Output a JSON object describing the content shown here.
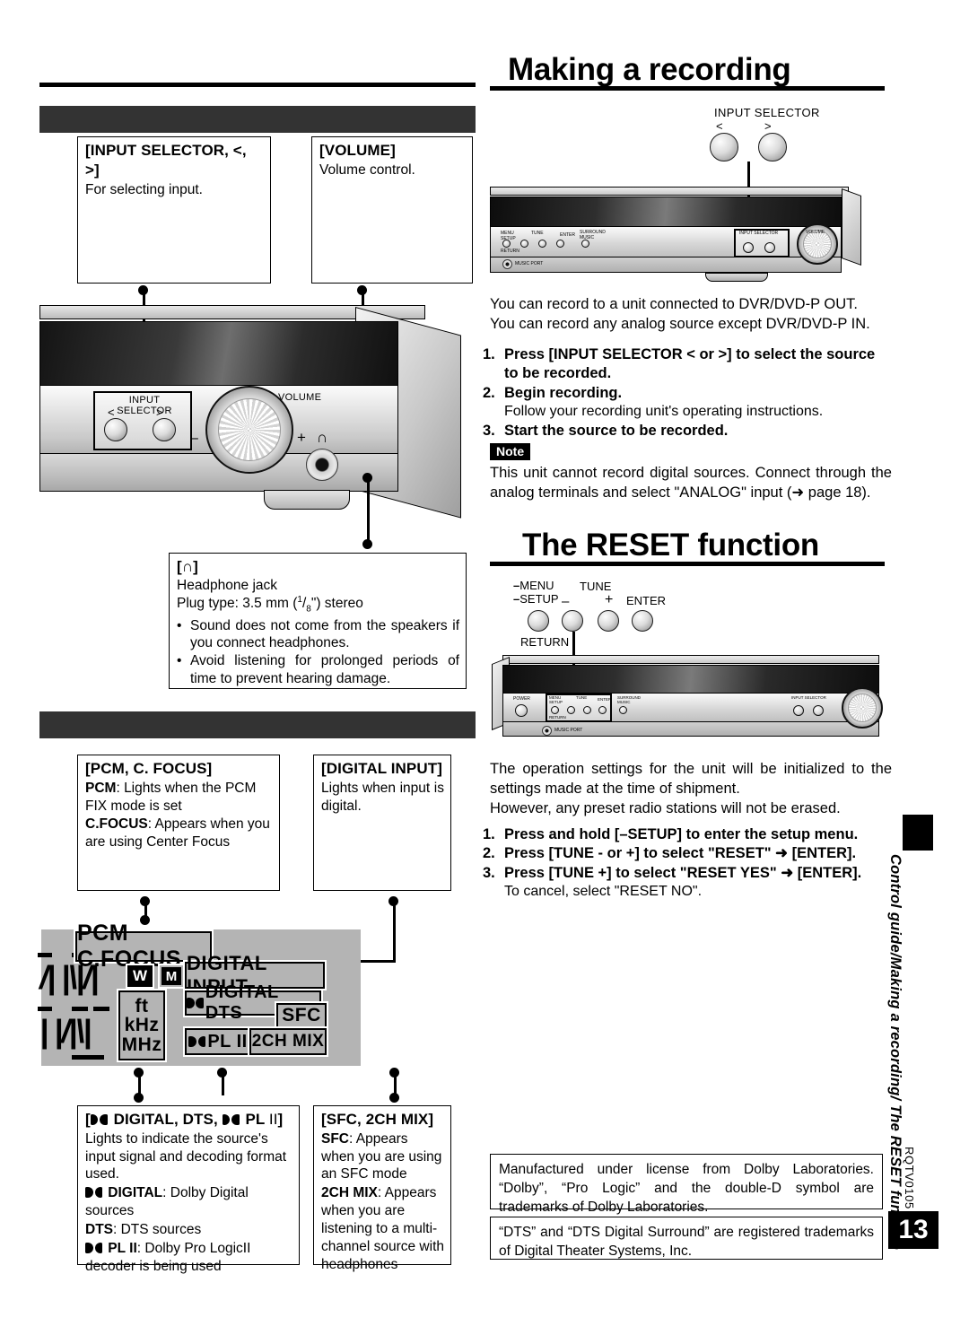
{
  "headings": {
    "making_recording": "Making a recording",
    "reset_function": "The RESET function"
  },
  "left_column": {
    "callouts": [
      {
        "title": "[INPUT SELECTOR, <, >]",
        "body": "For selecting input."
      },
      {
        "title": "[VOLUME]",
        "body": "Volume control."
      }
    ],
    "headphone": {
      "title": "[∩]",
      "line1": "Headphone jack",
      "line2_pre": "Plug type: 3.5 mm (",
      "line2_frac_num": "1",
      "line2_frac_den": "8",
      "line2_post": "\") stereo",
      "bullets": [
        "Sound does not come from the speakers if you connect headphones.",
        "Avoid listening for prolonged periods of time to prevent hearing damage."
      ]
    },
    "pcm_focus": {
      "title": "[PCM, C. FOCUS]",
      "label1": "PCM",
      "text1": ": Lights when the PCM FIX mode is set",
      "label2": "C.FOCUS",
      "text2": ": Appears when you are using Center Focus"
    },
    "digital_input": {
      "title": "[DIGITAL INPUT]",
      "body": "Lights when input is digital."
    },
    "dolby_box": {
      "title_pre": "[",
      "title_dts": " DIGITAL, DTS, ",
      "title_pl": " PL ",
      "title_ii": "II",
      "title_post": "]",
      "body": "Lights to indicate the source's input signal and decoding format used.",
      "rows": [
        {
          "label": " DIGITAL",
          "text": ": Dolby Digital sources",
          "icon": "dolby-double-d"
        },
        {
          "label": "DTS",
          "text": ": DTS sources",
          "icon": "none"
        },
        {
          "label": " PL II",
          "text": ": Dolby Pro LogicII decoder is being used",
          "icon": "dolby-double-d"
        }
      ]
    },
    "sfc_box": {
      "title": "[SFC, 2CH MIX]",
      "label1": "SFC",
      "text1": ": Appears when you are using an SFC mode",
      "label2": "2CH MIX",
      "text2": ": Appears when you are listening to a multi-channel source with headphones"
    }
  },
  "lcd_display": {
    "indicators": [
      "PCM  C.FOCUS",
      "W",
      "M",
      "DIGITAL  INPUT",
      "DIGITAL  DTS",
      "ft",
      "kHz",
      "MHz",
      "PL II",
      "SFC",
      "2CH MIX"
    ]
  },
  "device_labels": {
    "input_selector": "INPUT SELECTOR",
    "left_arrow": "<",
    "right_arrow": ">",
    "volume": "VOLUME",
    "minus": "–",
    "plus": "+",
    "headphone_glyph": "∩",
    "menu": "MENU",
    "setup": "SETUP",
    "tune": "TUNE",
    "enter": "ENTER",
    "return": "RETURN",
    "power": "POWER",
    "surround": "SURROUND",
    "music": "MUSIC",
    "music_port": "MUSIC PORT"
  },
  "right_column": {
    "intro": [
      "You can record to a unit connected to DVR/DVD-P OUT.",
      "You can record any analog source except DVR/DVD-P IN."
    ],
    "steps": [
      {
        "num": "1.",
        "text": "Press [INPUT SELECTOR < or >] to select the source to be recorded.",
        "sub": ""
      },
      {
        "num": "2.",
        "text": "Begin recording.",
        "sub": "Follow your recording unit's operating instructions."
      },
      {
        "num": "3.",
        "text": "Start the source to be recorded.",
        "sub": ""
      }
    ],
    "note_label": "Note",
    "note_text": "This unit cannot record digital sources. Connect through the analog terminals and select \"ANALOG\" input (➜ page 18).",
    "reset_intro": [
      "The operation settings for the unit will be initialized to the settings made at the time of shipment.",
      "However, any preset radio stations will not be erased."
    ],
    "reset_steps": [
      {
        "num": "1.",
        "text": "Press and hold [–SETUP] to enter the setup menu.",
        "sub": ""
      },
      {
        "num": "2.",
        "text": "Press [TUNE - or +] to select \"RESET\" ➜ [ENTER].",
        "sub": ""
      },
      {
        "num": "3.",
        "text": "Press [TUNE +] to select \"RESET YES\" ➜ [ENTER].",
        "sub": "To cancel, select \"RESET NO\"."
      }
    ],
    "legal": [
      "Manufactured under license from Dolby Laboratories. “Dolby”, “Pro Logic” and the double-D symbol are trademarks of Dolby Laboratories.",
      "“DTS” and “DTS Digital Surround” are registered trademarks of Digital Theater Systems, Inc."
    ]
  },
  "footer": {
    "side_tab": "Control guide/Making a recording/ The RESET function",
    "doc_code": "RQTV0105",
    "page_number": "13"
  },
  "colors": {
    "ink": "#000000",
    "dark_bar": "#333333",
    "lcd_bg": "#b4b4b4"
  }
}
